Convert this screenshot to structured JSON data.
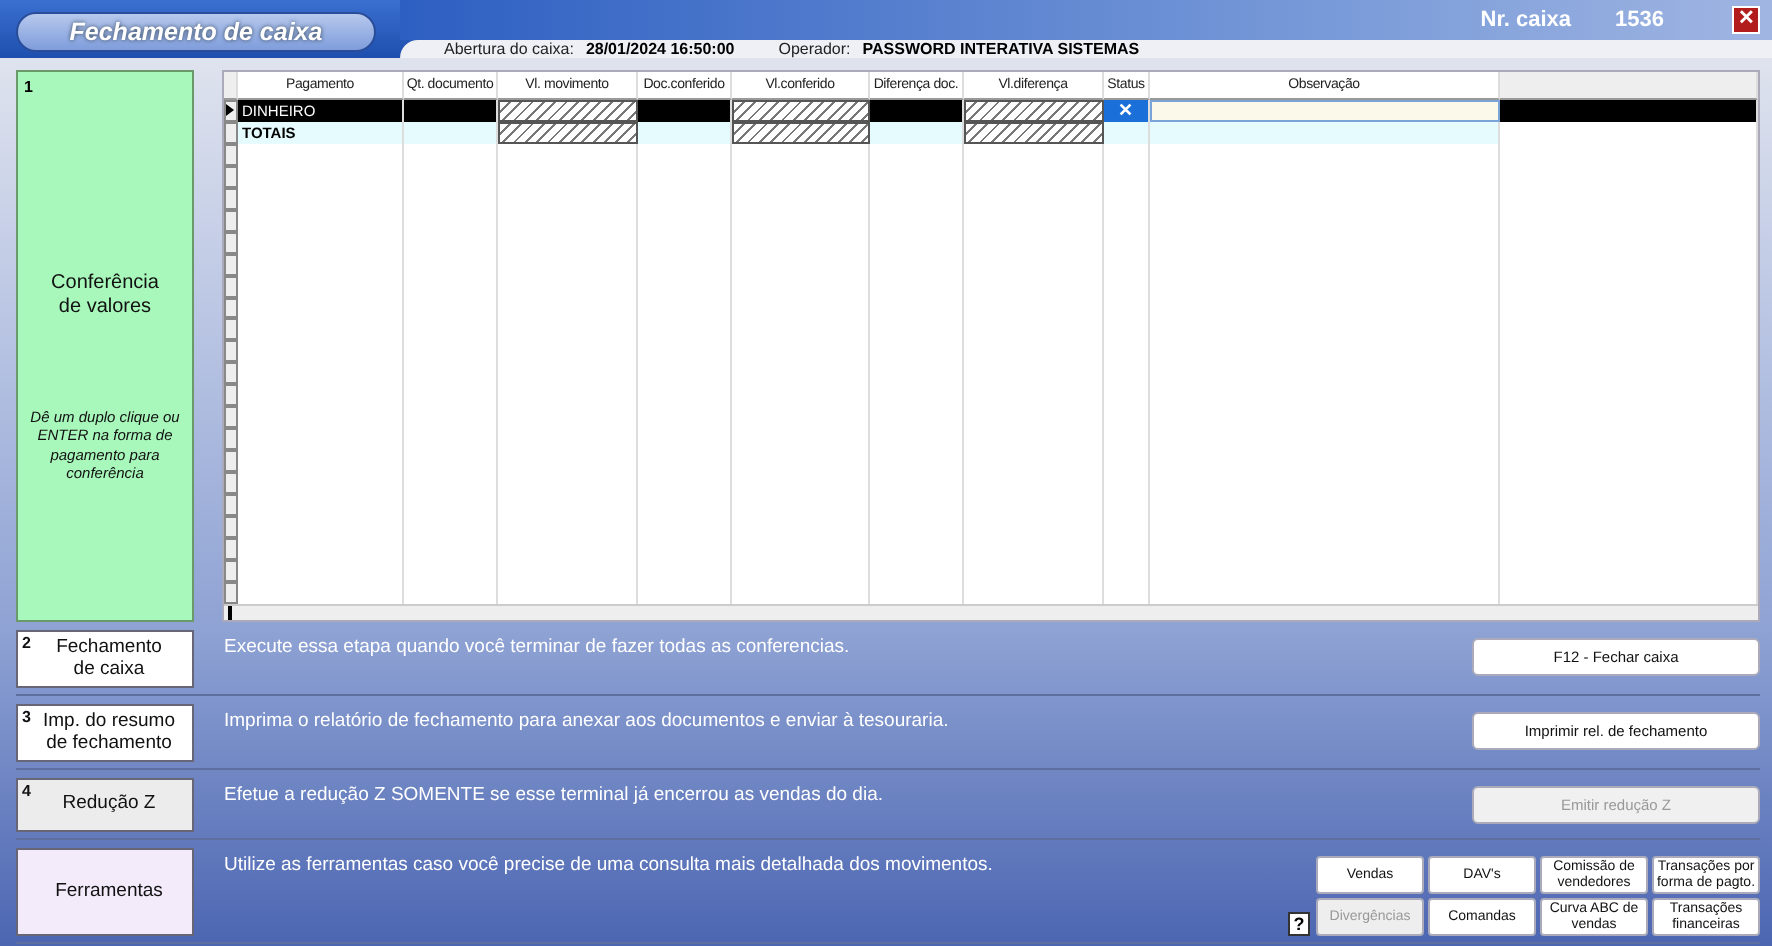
{
  "window": {
    "title": "Fechamento de caixa",
    "register_label": "Nr. caixa",
    "register_number": "1536",
    "close": "✕"
  },
  "info": [
    {
      "label": "Abertura do caixa:",
      "value": "28/01/2024 16:50:00"
    },
    {
      "label": "Operador:",
      "value": "PASSWORD INTERATIVA SISTEMAS"
    }
  ],
  "conference": {
    "number": "1",
    "title": "Conferência\nde valores",
    "hint": "Dê um duplo clique ou ENTER na forma de pagamento para conferência",
    "selected": true
  },
  "table": {
    "columns": [
      "Pagamento",
      "Qt. documento",
      "Vl. movimento",
      "Doc.conferido",
      "Vl.conferido",
      "Diferença doc.",
      "Vl.diferença",
      "Status",
      "Observação"
    ],
    "rows": [
      {
        "kind": "item",
        "selected": true,
        "cells": [
          {
            "kind": "text",
            "text": "DINHEIRO"
          },
          {
            "kind": "blank"
          },
          {
            "kind": "hatched"
          },
          {
            "kind": "blank"
          },
          {
            "kind": "hatched"
          },
          {
            "kind": "blank"
          },
          {
            "kind": "hatched"
          },
          {
            "kind": "status",
            "text": "✕"
          },
          {
            "kind": "input"
          }
        ]
      },
      {
        "kind": "total",
        "selected": false,
        "cells": [
          {
            "kind": "text",
            "text": "TOTAIS"
          },
          {
            "kind": "blank"
          },
          {
            "kind": "hatched"
          },
          {
            "kind": "blank"
          },
          {
            "kind": "hatched"
          },
          {
            "kind": "blank"
          },
          {
            "kind": "hatched"
          },
          {
            "kind": "blank"
          },
          {
            "kind": "blank"
          }
        ]
      }
    ]
  },
  "steps": [
    {
      "number": "2",
      "title": "Fechamento\nde caixa",
      "description": "Execute essa etapa quando você terminar de fazer todas as conferencias.",
      "disabled": false,
      "button": {
        "label": "F12 - Fechar caixa",
        "disabled": false
      }
    },
    {
      "number": "3",
      "title": "Imp. do resumo\nde fechamento",
      "description": "Imprima o relatório de fechamento para anexar aos documentos e enviar à tesouraria.",
      "disabled": false,
      "button": {
        "label": "Imprimir rel. de fechamento",
        "disabled": false
      }
    },
    {
      "number": "4",
      "title": "Redução Z",
      "description": "Efetue a redução Z SOMENTE se esse terminal já encerrou as vendas do dia.",
      "disabled": true,
      "button": {
        "label": "Emitir redução Z",
        "disabled": true
      }
    }
  ],
  "tools": {
    "title": "Ferramentas",
    "description": "Utilize as ferramentas caso você precise de uma consulta mais detalhada dos movimentos.",
    "help": "?",
    "buttons": [
      {
        "label": "Vendas",
        "disabled": false
      },
      {
        "label": "DAV's",
        "disabled": false
      },
      {
        "label": "Comissão de vendedores",
        "disabled": false
      },
      {
        "label": "Transações por forma de pagto.",
        "disabled": false
      },
      {
        "label": "Divergências",
        "disabled": true
      },
      {
        "label": "Comandas",
        "disabled": false
      },
      {
        "label": "Curva ABC de vendas",
        "disabled": false
      },
      {
        "label": "Transações financeiras",
        "disabled": false
      }
    ]
  }
}
